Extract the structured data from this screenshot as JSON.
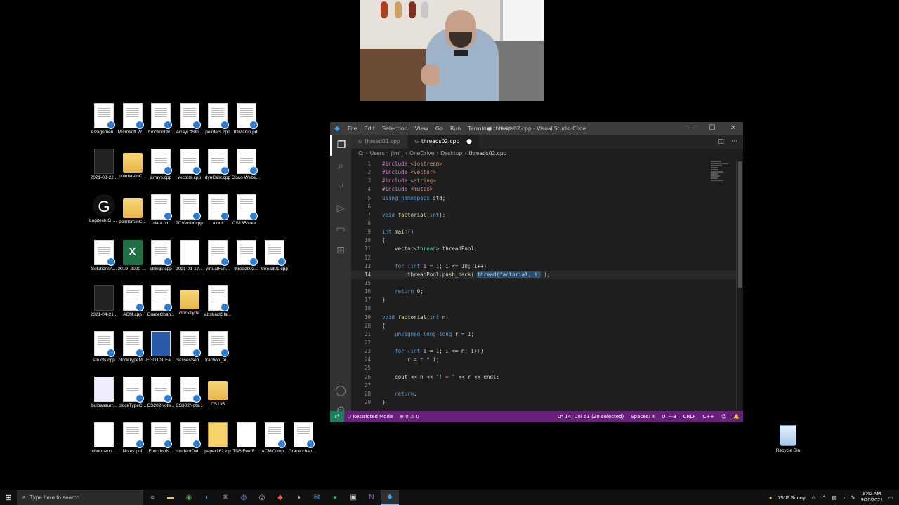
{
  "desktop": {
    "icons": [
      {
        "label": "Assignmen...",
        "kind": "doc"
      },
      {
        "label": "Microsoft Word - Pla...",
        "kind": "doc"
      },
      {
        "label": "functionOv...",
        "kind": "doc"
      },
      {
        "label": "ArrayOfStri...",
        "kind": "doc"
      },
      {
        "label": "pointers.cpp",
        "kind": "doc"
      },
      {
        "label": "IOManip.pdf",
        "kind": "doc"
      },
      {
        "label": "2021-08-22...",
        "kind": "dark"
      },
      {
        "label": "pointersInC...",
        "kind": "folder"
      },
      {
        "label": "arrays.cpp",
        "kind": "doc"
      },
      {
        "label": "vectors.cpp",
        "kind": "doc"
      },
      {
        "label": "dynCast.cpp",
        "kind": "doc"
      },
      {
        "label": "Cisco Webex Meetings",
        "kind": "doc"
      },
      {
        "label": "Logitech G HUB",
        "kind": "logi"
      },
      {
        "label": "pointersInC...",
        "kind": "folder"
      },
      {
        "label": "data.txt",
        "kind": "doc"
      },
      {
        "label": "2DVector.cpp",
        "kind": "doc"
      },
      {
        "label": "a.out",
        "kind": "doc"
      },
      {
        "label": "CS135Note...",
        "kind": "doc"
      },
      {
        "label": "SolutionsA...",
        "kind": "doc"
      },
      {
        "label": "2019_2020 UNLV ACM...",
        "kind": "excel"
      },
      {
        "label": "strings.cpp",
        "kind": "doc"
      },
      {
        "label": "2021-01-17...",
        "kind": "thumb"
      },
      {
        "label": "virtualFun...",
        "kind": "doc"
      },
      {
        "label": "threads02...",
        "kind": "doc"
      },
      {
        "label": "thread01.cpp",
        "kind": "doc"
      },
      {
        "label": "2021-04-21...",
        "kind": "dark"
      },
      {
        "label": "ACM.cpp",
        "kind": "doc"
      },
      {
        "label": "GradeChan...",
        "kind": "doc"
      },
      {
        "label": "clockType",
        "kind": "folder"
      },
      {
        "label": "abstractCla...",
        "kind": "doc"
      },
      {
        "label": "structs.cpp",
        "kind": "doc"
      },
      {
        "label": "clockTypeM...",
        "kind": "doc"
      },
      {
        "label": "EGG101 Fall 2020.pptx",
        "kind": "thumb-blue"
      },
      {
        "label": "classesSep...",
        "kind": "doc"
      },
      {
        "label": "fraction_te...",
        "kind": "doc"
      },
      {
        "label": "bulbasaurr...",
        "kind": "thumb-green"
      },
      {
        "label": "clockTypeC...",
        "kind": "doc"
      },
      {
        "label": "CS202Note...",
        "kind": "doc"
      },
      {
        "label": "CS302Note...",
        "kind": "doc"
      },
      {
        "label": "CS135",
        "kind": "folder"
      },
      {
        "label": "churmend...",
        "kind": "thumb"
      },
      {
        "label": "Notes.pdf",
        "kind": "doc"
      },
      {
        "label": "FunctionN...",
        "kind": "doc"
      },
      {
        "label": "studentDat...",
        "kind": "doc"
      },
      {
        "label": "paper162.zip",
        "kind": "zip"
      },
      {
        "label": "ITN6 Fee Form.pdf",
        "kind": "thumb"
      },
      {
        "label": "ACMComp...",
        "kind": "doc"
      },
      {
        "label": "Grade change for...",
        "kind": "doc"
      }
    ],
    "recycle_bin": "Recycle Bin"
  },
  "vscode": {
    "menu": [
      "File",
      "Edit",
      "Selection",
      "View",
      "Go",
      "Run",
      "Terminal",
      "Help"
    ],
    "title": "● threads02.cpp - Visual Studio Code",
    "tabs": [
      {
        "label": "thread01.cpp",
        "active": false
      },
      {
        "label": "threads02.cpp",
        "active": true,
        "dirty": "●"
      }
    ],
    "breadcrumb": [
      "C:",
      "Users",
      "jimi_",
      "OneDrive",
      "Desktop",
      "threads02.cpp"
    ],
    "code_lines": [
      "#include <iostream>",
      "#include <vector>",
      "#include <string>",
      "#include <mutex>",
      "using namespace std;",
      "",
      "void factorial(int);",
      "",
      "int main()",
      "{",
      "    vector<thread> threadPool;",
      "",
      "    for (int i = 1; i <= 10; i++)",
      "        threadPool.push_back( thread(factorial, i) );",
      "",
      "    return 0;",
      "}",
      "",
      "void factorial(int n)",
      "{",
      "    unsigned long long r = 1;",
      "",
      "    for (int i = 1; i <= n; i++)",
      "        r = r * i;",
      "",
      "    cout << n << \"! = \" << r << endl;",
      "",
      "    return;",
      "}"
    ],
    "cursor_line": 14,
    "status": {
      "restricted": "Restricted Mode",
      "problems": "⊗ 0 ⚠ 0",
      "position": "Ln 14, Col 51 (20 selected)",
      "spaces": "Spaces: 4",
      "encoding": "UTF-8",
      "eol": "CRLF",
      "language": "C++"
    }
  },
  "taskbar": {
    "search_placeholder": "Type here to search",
    "weather": "75°F Sunny",
    "time": "8:42 AM",
    "date": "9/20/2021"
  },
  "colors": {
    "statusbar": "#68217a",
    "vscode_bg": "#1e1e1e",
    "titlebar": "#3c3c3c"
  }
}
